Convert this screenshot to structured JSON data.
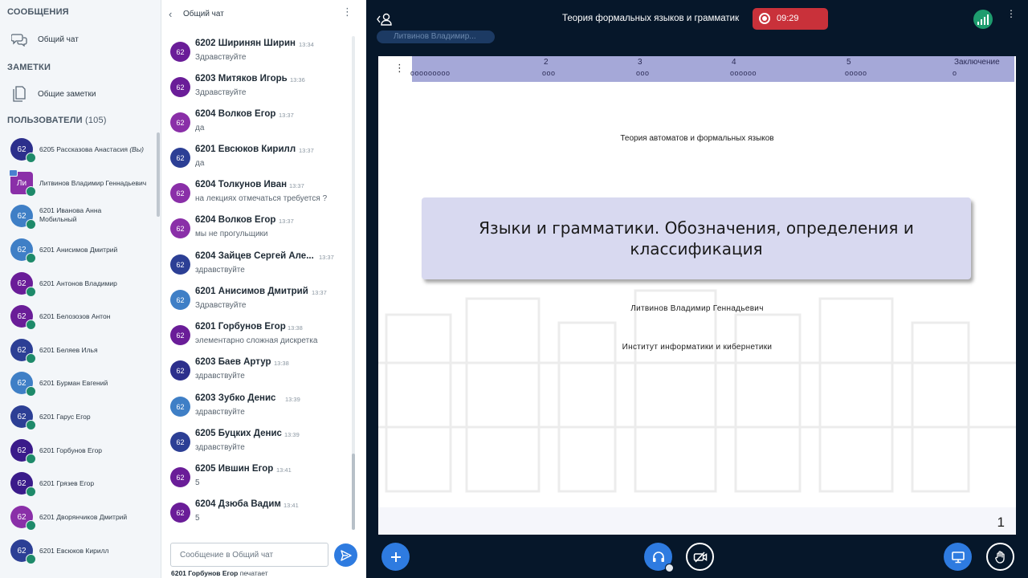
{
  "sidebar": {
    "messages_title": "СООБЩЕНИЯ",
    "public_chat_label": "Общий чат",
    "notes_title": "ЗАМЕТКИ",
    "shared_notes_label": "Общие заметки",
    "users_title": "ПОЛЬЗОВАТЕЛИ",
    "users_count": "(105)",
    "users": [
      {
        "avatar": "62",
        "name": "6205 Рассказова Анастасия",
        "suffix": "(Вы)",
        "color": "#2c2f8c"
      },
      {
        "avatar": "Ли",
        "name": "Литвинов Владимир Геннадьевич",
        "suffix": "",
        "color": "#8a2fa8"
      },
      {
        "avatar": "62",
        "name": "6201 Иванова Анна Мобильный",
        "suffix": "",
        "color": "#3f7fc6"
      },
      {
        "avatar": "62",
        "name": "6201 Анисимов Дмитрий",
        "suffix": "",
        "color": "#3f7fc6"
      },
      {
        "avatar": "62",
        "name": "6201 Антонов Владимир",
        "suffix": "",
        "color": "#6a1d98"
      },
      {
        "avatar": "62",
        "name": "6201 Белозозов Антон",
        "suffix": "",
        "color": "#6a1d98"
      },
      {
        "avatar": "62",
        "name": "6201 Беляев Илья",
        "suffix": "",
        "color": "#2c3f95"
      },
      {
        "avatar": "62",
        "name": "6201 Бурман Евгений",
        "suffix": "",
        "color": "#3f7fc6"
      },
      {
        "avatar": "62",
        "name": "6201 Гарус Егор",
        "suffix": "",
        "color": "#2c3f95"
      },
      {
        "avatar": "62",
        "name": "6201 Горбунов Егор",
        "suffix": "",
        "color": "#3a1b8a"
      },
      {
        "avatar": "62",
        "name": "6201 Грязев Егор",
        "suffix": "",
        "color": "#3a1b8a"
      },
      {
        "avatar": "62",
        "name": "6201 Дворянчиков Дмитрий",
        "suffix": "",
        "color": "#8a2fa8"
      },
      {
        "avatar": "62",
        "name": "6201 Евсюков Кирилл",
        "suffix": "",
        "color": "#2c3f95"
      }
    ]
  },
  "chat": {
    "title": "Общий чат",
    "messages": [
      {
        "avatar": "62",
        "color": "#6a1d98",
        "name": "6202 Ширинян Ширин",
        "time": "13:34",
        "text": "Здравствуйте"
      },
      {
        "avatar": "62",
        "color": "#6a1d98",
        "name": "6203 Митяков Игорь",
        "time": "13:36",
        "text": "Здравствуйте"
      },
      {
        "avatar": "62",
        "color": "#8a2fa8",
        "name": "6204 Волков Егор",
        "time": "13:37",
        "text": "да"
      },
      {
        "avatar": "62",
        "color": "#2c3f95",
        "name": "6201 Евсюков Кирилл",
        "time": "13:37",
        "text": "да"
      },
      {
        "avatar": "62",
        "color": "#8a2fa8",
        "name": "6204 Толкунов Иван",
        "time": "13:37",
        "text": "на лекциях отмечаться требуется ?"
      },
      {
        "avatar": "62",
        "color": "#8a2fa8",
        "name": "6204 Волков Егор",
        "time": "13:37",
        "text": "мы не прогульщики"
      },
      {
        "avatar": "62",
        "color": "#2c3f95",
        "name": "6204 Зайцев Сергей Але...",
        "time": "13:37",
        "text": "здравствуйте"
      },
      {
        "avatar": "62",
        "color": "#3f7fc6",
        "name": "6201 Анисимов Дмитрий",
        "time": "13:37",
        "text": "Здравствуйте"
      },
      {
        "avatar": "62",
        "color": "#6a1d98",
        "name": "6201 Горбунов Егор",
        "time": "13:38",
        "text": "элементарно сложная дискретка"
      },
      {
        "avatar": "62",
        "color": "#2c2f8c",
        "name": "6203 Баев Артур",
        "time": "13:38",
        "text": "здравствуйте"
      },
      {
        "avatar": "62",
        "color": "#3f7fc6",
        "name": "6203 Зубко Денис",
        "time": "13:39",
        "text": "здравствуйте"
      },
      {
        "avatar": "62",
        "color": "#2c3f95",
        "name": "6205 Буцких Денис",
        "time": "13:39",
        "text": "здравствуйте"
      },
      {
        "avatar": "62",
        "color": "#6a1d98",
        "name": "6205 Ившин Егор",
        "time": "13:41",
        "text": "5"
      },
      {
        "avatar": "62",
        "color": "#6a1d98",
        "name": "6204 Дзюба Вадим",
        "time": "13:41",
        "text": "5"
      }
    ],
    "input_placeholder": "Сообщение в Общий чат",
    "typing_user": "6201",
    "typing_name": "Горбунов Егор",
    "typing_suffix": "печатает"
  },
  "main": {
    "meeting_title": "Теория формальных языков и грамматик",
    "recording_time": "09:29",
    "presenter_chip": "Литвинов Владимир...",
    "accent_color": "#2e7be0",
    "record_color": "#c9313a"
  },
  "slide": {
    "nav_sections": [
      {
        "label": "",
        "dots": "ooooooooo"
      },
      {
        "label": "2",
        "dots": "ooo"
      },
      {
        "label": "3",
        "dots": "ooo"
      },
      {
        "label": "4",
        "dots": "oooooo"
      },
      {
        "label": "5",
        "dots": "ooooo"
      },
      {
        "label": "Заключение",
        "dots": "o"
      }
    ],
    "course": "Теория автоматов и формальных языков",
    "title_line1": "Языки и грамматики. Обозначения, определения и",
    "title_line2": "классификация",
    "author": "Литвинов Владимир Геннадьевич",
    "institute": "Институт информатики и кибернетики",
    "page": "1"
  }
}
